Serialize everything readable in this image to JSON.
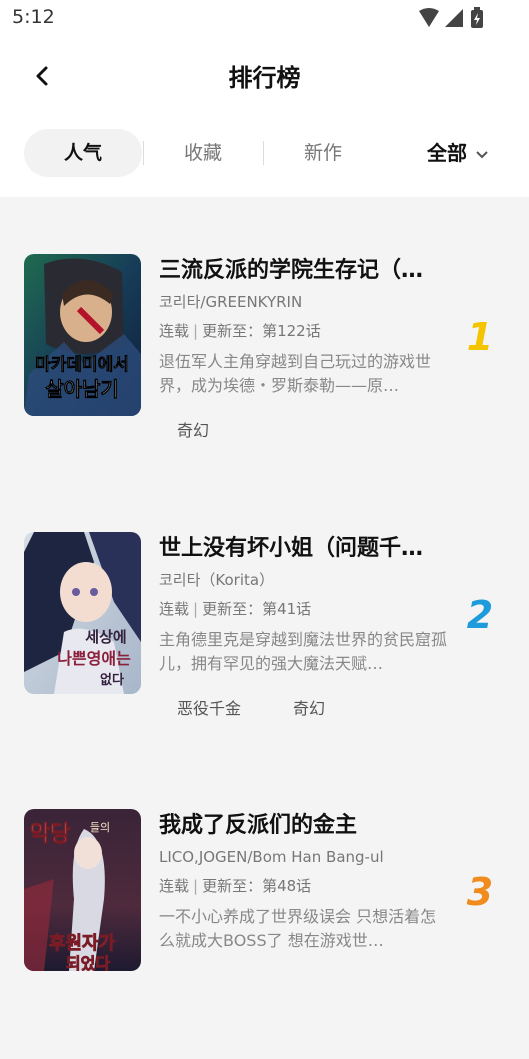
{
  "status_bar": {
    "time": "5:12"
  },
  "header": {
    "title": "排行榜"
  },
  "tabs": [
    {
      "label": "人气",
      "active": true
    },
    {
      "label": "收藏",
      "active": false
    },
    {
      "label": "新作",
      "active": false
    }
  ],
  "filter": {
    "label": "全部"
  },
  "books": [
    {
      "rank": "1",
      "rank_color": "#f5c400",
      "title": "三流反派的学院生存记（…",
      "author": "코리타/GREENKYRIN",
      "status": "连载",
      "update_label": "更新至：第122话",
      "description": "退伍军人主角穿越到自己玩过的游戏世界，成为埃德・罗斯泰勒——原…",
      "tags": [
        "奇幻"
      ],
      "cover_text": [
        "마카데미에서",
        "살아남기"
      ]
    },
    {
      "rank": "2",
      "rank_color": "#1e9bdb",
      "title": "世上没有坏小姐（问题千…",
      "author": "코리타（Korita）",
      "status": "连载",
      "update_label": "更新至：第41话",
      "description": "主角德里克是穿越到魔法世界的贫民窟孤儿，拥有罕见的强大魔法天赋…",
      "tags": [
        "恶役千金",
        "奇幻"
      ],
      "cover_text": [
        "세상에",
        "나쁜영애는",
        "없다"
      ]
    },
    {
      "rank": "3",
      "rank_color": "#f08c1e",
      "title": "我成了反派们的金主",
      "author": "LICO,JOGEN/Bom Han Bang-ul",
      "status": "连载",
      "update_label": "更新至：第48话",
      "description": "一不小心养成了世界级误会 只想活着怎么就成大BOSS了 想在游戏世…",
      "tags": [],
      "cover_text": [
        "악당",
        "들의",
        "후원자가",
        "되었다"
      ]
    }
  ]
}
